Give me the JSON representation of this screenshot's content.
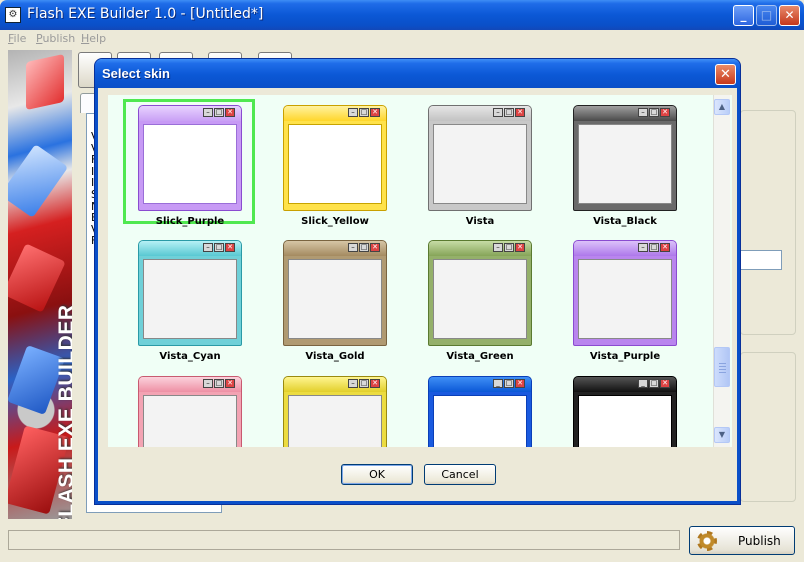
{
  "app": {
    "title": "Flash EXE Builder 1.0 - [Untitled*]",
    "window_controls": [
      "minimize",
      "maximize",
      "close"
    ]
  },
  "menu": {
    "items": [
      {
        "label": "File"
      },
      {
        "label": "Publish"
      },
      {
        "label": "Help"
      }
    ]
  },
  "sidebar": {
    "brand_text": "FLASH EXE BUILDER"
  },
  "background": {
    "list_initials": "V\nV\nF\nI\nI\nS\nN\nE\nV\nF"
  },
  "footer": {
    "publish_label": "Publish",
    "publish_icon": "gear-icon"
  },
  "dialog": {
    "title": "Select skin",
    "ok_label": "OK",
    "cancel_label": "Cancel",
    "selected_skin": "Slick_Purple",
    "skins": [
      {
        "name": "Slick_Purple",
        "theme": "t-purple",
        "ctrl": [
          "–",
          "□",
          "✕"
        ]
      },
      {
        "name": "Slick_Yellow",
        "theme": "t-yellow",
        "ctrl": [
          "–",
          "□",
          "✕"
        ]
      },
      {
        "name": "Vista",
        "theme": "t-vista",
        "ctrl": [
          "–",
          "□",
          "✕"
        ]
      },
      {
        "name": "Vista_Black",
        "theme": "t-black",
        "ctrl": [
          "–",
          "□",
          "✕"
        ]
      },
      {
        "name": "Vista_Cyan",
        "theme": "t-cyan",
        "ctrl": [
          "–",
          "□",
          "✕"
        ]
      },
      {
        "name": "Vista_Gold",
        "theme": "t-gold",
        "ctrl": [
          "–",
          "□",
          "✕"
        ]
      },
      {
        "name": "Vista_Green",
        "theme": "t-green",
        "ctrl": [
          "–",
          "□",
          "✕"
        ]
      },
      {
        "name": "Vista_Purple",
        "theme": "t-vpurple",
        "ctrl": [
          "–",
          "□",
          "✕"
        ]
      },
      {
        "name": "",
        "theme": "t-pink",
        "ctrl": [
          "–",
          "□",
          "✕"
        ]
      },
      {
        "name": "",
        "theme": "t-yellow2",
        "ctrl": [
          "–",
          "□",
          "✕"
        ]
      },
      {
        "name": "",
        "theme": "t-xpblue",
        "ctrl": [
          "_",
          "□",
          "✕"
        ]
      },
      {
        "name": "",
        "theme": "t-xpblack",
        "ctrl": [
          "_",
          "□",
          "✕"
        ]
      }
    ]
  }
}
